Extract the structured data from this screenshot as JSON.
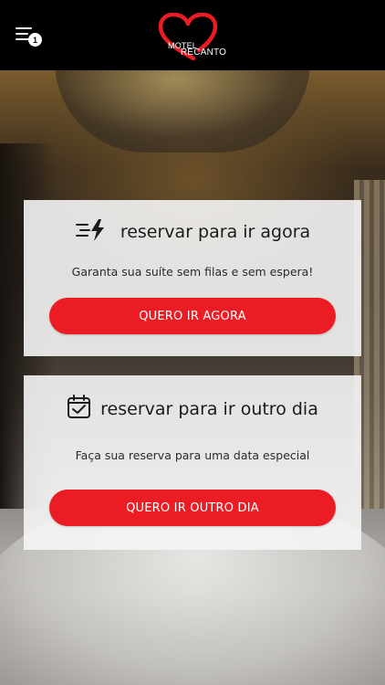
{
  "header": {
    "menu_icon": "menu-lines-icon",
    "notification_count": "1",
    "logo": {
      "line1": "MOTEL",
      "line2": "RECANTO",
      "heart_color": "#ec1c24"
    }
  },
  "cards": [
    {
      "icon": "speed-bolt-icon",
      "title": "reservar para ir agora",
      "description": "Garanta sua suíte sem filas e sem espera!",
      "button_label": "QUERO IR AGORA"
    },
    {
      "icon": "calendar-check-icon",
      "title": "reservar para ir outro dia",
      "description": "Faça sua reserva para uma data especial",
      "button_label": "QUERO IR OUTRO DIA"
    }
  ],
  "colors": {
    "accent": "#ec1c24",
    "header_bg": "#000000",
    "card_bg": "#f5f5f5"
  }
}
